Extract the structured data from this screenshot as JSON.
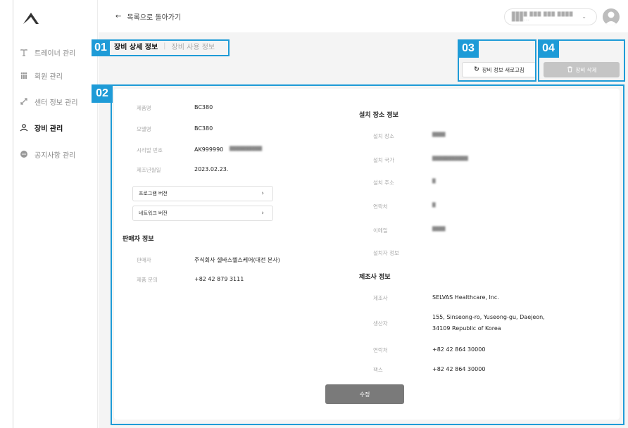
{
  "sidebar": {
    "items": [
      {
        "label": "트레이너 관리",
        "icon": "trainer-icon"
      },
      {
        "label": "회원 관리",
        "icon": "members-icon"
      },
      {
        "label": "센터 정보 관리",
        "icon": "center-icon"
      },
      {
        "label": "장비 관리",
        "icon": "equipment-icon"
      },
      {
        "label": "공지사항 관리",
        "icon": "notice-icon"
      }
    ]
  },
  "header": {
    "back_label": "목록으로 돌아가기",
    "account_name": "████ ███ ███ ████ ███...",
    "chevron": "⌄"
  },
  "tabs": {
    "active": "장비 상세 정보",
    "separator": "|",
    "inactive": "장비 사용 정보"
  },
  "actions": {
    "refresh_label": "장비 정보 새로고침",
    "delete_label": "장비 삭제"
  },
  "equipment": {
    "fields": [
      {
        "label": "제품명",
        "value": "BC380"
      },
      {
        "label": "모델명",
        "value": "BC380"
      },
      {
        "label": "시리얼 번호",
        "value": "AK999990"
      },
      {
        "label": "제조년월일",
        "value": "2023.02.23."
      }
    ],
    "serial_masked": "██████████",
    "program_version": "프로그램 버전",
    "network_version": "네트워크 버전",
    "expand_arrow": "›"
  },
  "seller": {
    "title": "판매자 정보",
    "fields": [
      {
        "label": "판매자",
        "value": "주식회사 셀바스헬스케어(대전 본사)"
      },
      {
        "label": "제품 문의",
        "value": "+82 42 879 3111"
      }
    ]
  },
  "install": {
    "title": "설치 장소 정보",
    "fields": [
      {
        "label": "설치 장소",
        "value": "████"
      },
      {
        "label": "설치 국가",
        "value": "███████████"
      },
      {
        "label": "설치 주소",
        "value": "█"
      },
      {
        "label": "연락처",
        "value": "█"
      },
      {
        "label": "이메일",
        "value": "████"
      },
      {
        "label": "설치자 정보",
        "value": ""
      }
    ]
  },
  "manufacturer": {
    "title": "제조사 정보",
    "fields": [
      {
        "label": "제조사",
        "value": "SELVAS Healthcare, Inc."
      },
      {
        "label": "생산자",
        "value_line1": "155, Sinseong-ro, Yuseong-gu, Daejeon,",
        "value_line2": "34109 Republic of Korea"
      },
      {
        "label": "연락처",
        "value": "+82 42 864 30000"
      },
      {
        "label": "팩스",
        "value": "+82 42 864 30000"
      }
    ]
  },
  "edit_label": "수정",
  "callouts": [
    "01",
    "02",
    "03",
    "04"
  ],
  "colors": {
    "callout": "#1e9bd7",
    "delete_button": "#c5c5c5",
    "edit_button": "#7a7a7a"
  }
}
